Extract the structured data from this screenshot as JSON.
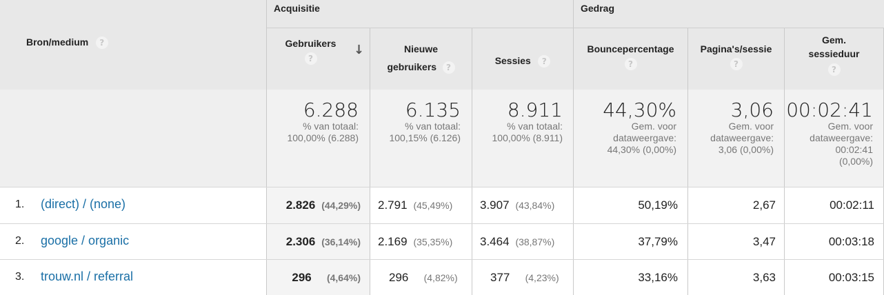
{
  "header": {
    "dimension_label": "Bron/medium",
    "groups": {
      "acquisition": "Acquisitie",
      "behavior": "Gedrag"
    },
    "columns": {
      "users": "Gebruikers",
      "new_users_line1": "Nieuwe",
      "new_users_line2": "gebruikers",
      "sessions": "Sessies",
      "bounce": "Bouncepercentage",
      "pages": "Pagina's/sessie",
      "duration_line1": "Gem.",
      "duration_line2": "sessieduur"
    },
    "help_icon": "?",
    "sort_icon": "↓"
  },
  "totals": {
    "users": {
      "value": "6.288",
      "l1": "% van totaal:",
      "l2": "100,00% (6.288)"
    },
    "new_users": {
      "value": "6.135",
      "l1": "% van totaal:",
      "l2": "100,15% (6.126)"
    },
    "sessions": {
      "value": "8.911",
      "l1": "% van totaal:",
      "l2": "100,00% (8.911)"
    },
    "bounce": {
      "value": "44,30%",
      "l1": "Gem. voor",
      "l2": "dataweergave:",
      "l3": "44,30% (0,00%)"
    },
    "pages": {
      "value": "3,06",
      "l1": "Gem. voor",
      "l2": "dataweergave:",
      "l3": "3,06 (0,00%)"
    },
    "duration": {
      "value": "00:02:41",
      "l1": "Gem. voor",
      "l2": "dataweergave:",
      "l3": "00:02:41",
      "l4": "(0,00%)"
    }
  },
  "rows": [
    {
      "num": "1.",
      "source": "(direct) / (none)",
      "users": "2.826",
      "users_pct": "(44,29%)",
      "new_users": "2.791",
      "new_users_pct": "(45,49%)",
      "sessions": "3.907",
      "sessions_pct": "(43,84%)",
      "bounce": "50,19%",
      "pages": "2,67",
      "duration": "00:02:11"
    },
    {
      "num": "2.",
      "source": "google / organic",
      "users": "2.306",
      "users_pct": "(36,14%)",
      "new_users": "2.169",
      "new_users_pct": "(35,35%)",
      "sessions": "3.464",
      "sessions_pct": "(38,87%)",
      "bounce": "37,79%",
      "pages": "3,47",
      "duration": "00:03:18"
    },
    {
      "num": "3.",
      "source": "trouw.nl / referral",
      "users": "296",
      "users_pct": "(4,64%)",
      "new_users": "296",
      "new_users_pct": "(4,82%)",
      "sessions": "377",
      "sessions_pct": "(4,23%)",
      "bounce": "33,16%",
      "pages": "3,63",
      "duration": "00:03:15"
    }
  ],
  "colors": {
    "link": "#1a6fa6",
    "header_bg": "#e8e8e8",
    "total_bg": "#f2f2f2"
  }
}
